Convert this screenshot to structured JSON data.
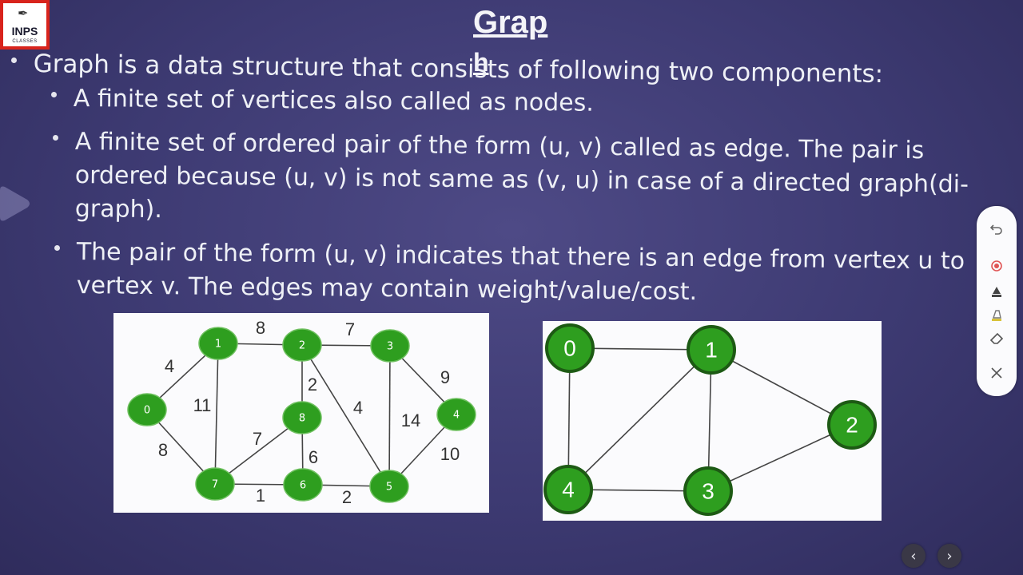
{
  "logo": {
    "name": "INPS",
    "sub": "CLASSES"
  },
  "slide": {
    "title": "Grap",
    "title_tail": "h",
    "lines": {
      "l1": "Graph is a data structure that consists of following two components:",
      "l2": "A finite set of vertices also called as nodes.",
      "l3a": "A finite set of ordered pair of the form (u, v) called as edge. The pair is",
      "l3b": "ordered because (u, v) is not same as (v, u) in case of a directed graph(di-",
      "l3c": "graph).",
      "l4a": "The pair of the form (u, v) indicates that there is an edge from vertex u to",
      "l4b": "vertex v. The edges may contain weight/value/cost."
    }
  },
  "graph1": {
    "nodes": [
      {
        "id": "0",
        "label": "0"
      },
      {
        "id": "1",
        "label": "1"
      },
      {
        "id": "2",
        "label": "2"
      },
      {
        "id": "3",
        "label": "3"
      },
      {
        "id": "4",
        "label": "4"
      },
      {
        "id": "5",
        "label": "5"
      },
      {
        "id": "6",
        "label": "6"
      },
      {
        "id": "7",
        "label": "7"
      },
      {
        "id": "8",
        "label": "8"
      }
    ],
    "edges": [
      {
        "from": "0",
        "to": "1",
        "weight": "4"
      },
      {
        "from": "1",
        "to": "2",
        "weight": "8"
      },
      {
        "from": "2",
        "to": "3",
        "weight": "7"
      },
      {
        "from": "3",
        "to": "4",
        "weight": "9"
      },
      {
        "from": "0",
        "to": "7",
        "weight": "8"
      },
      {
        "from": "1",
        "to": "7",
        "weight": "11"
      },
      {
        "from": "2",
        "to": "8",
        "weight": "2"
      },
      {
        "from": "2",
        "to": "5",
        "weight": "4"
      },
      {
        "from": "3",
        "to": "5",
        "weight": "14"
      },
      {
        "from": "4",
        "to": "5",
        "weight": "10"
      },
      {
        "from": "7",
        "to": "8",
        "weight": "7"
      },
      {
        "from": "8",
        "to": "6",
        "weight": "6"
      },
      {
        "from": "7",
        "to": "6",
        "weight": "1"
      },
      {
        "from": "6",
        "to": "5",
        "weight": "2"
      }
    ]
  },
  "graph2": {
    "nodes": [
      {
        "id": "0",
        "label": "0"
      },
      {
        "id": "1",
        "label": "1"
      },
      {
        "id": "2",
        "label": "2"
      },
      {
        "id": "3",
        "label": "3"
      },
      {
        "id": "4",
        "label": "4"
      }
    ],
    "edges": [
      {
        "from": "0",
        "to": "1"
      },
      {
        "from": "0",
        "to": "4"
      },
      {
        "from": "1",
        "to": "4"
      },
      {
        "from": "1",
        "to": "3"
      },
      {
        "from": "1",
        "to": "2"
      },
      {
        "from": "4",
        "to": "3"
      },
      {
        "from": "3",
        "to": "2"
      }
    ]
  },
  "colors": {
    "node_fill": "#2e9e1f",
    "node_stroke": "#1d5a14",
    "edge": "#444444",
    "record_dot": "#e05555",
    "highlighter": "#d8c23a"
  },
  "toolbar": {
    "icons": [
      "undo-icon",
      "record-icon",
      "pen-icon",
      "highlighter-icon",
      "eraser-icon",
      "close-icon"
    ]
  },
  "nav": {
    "prev": "‹",
    "next": "›"
  }
}
